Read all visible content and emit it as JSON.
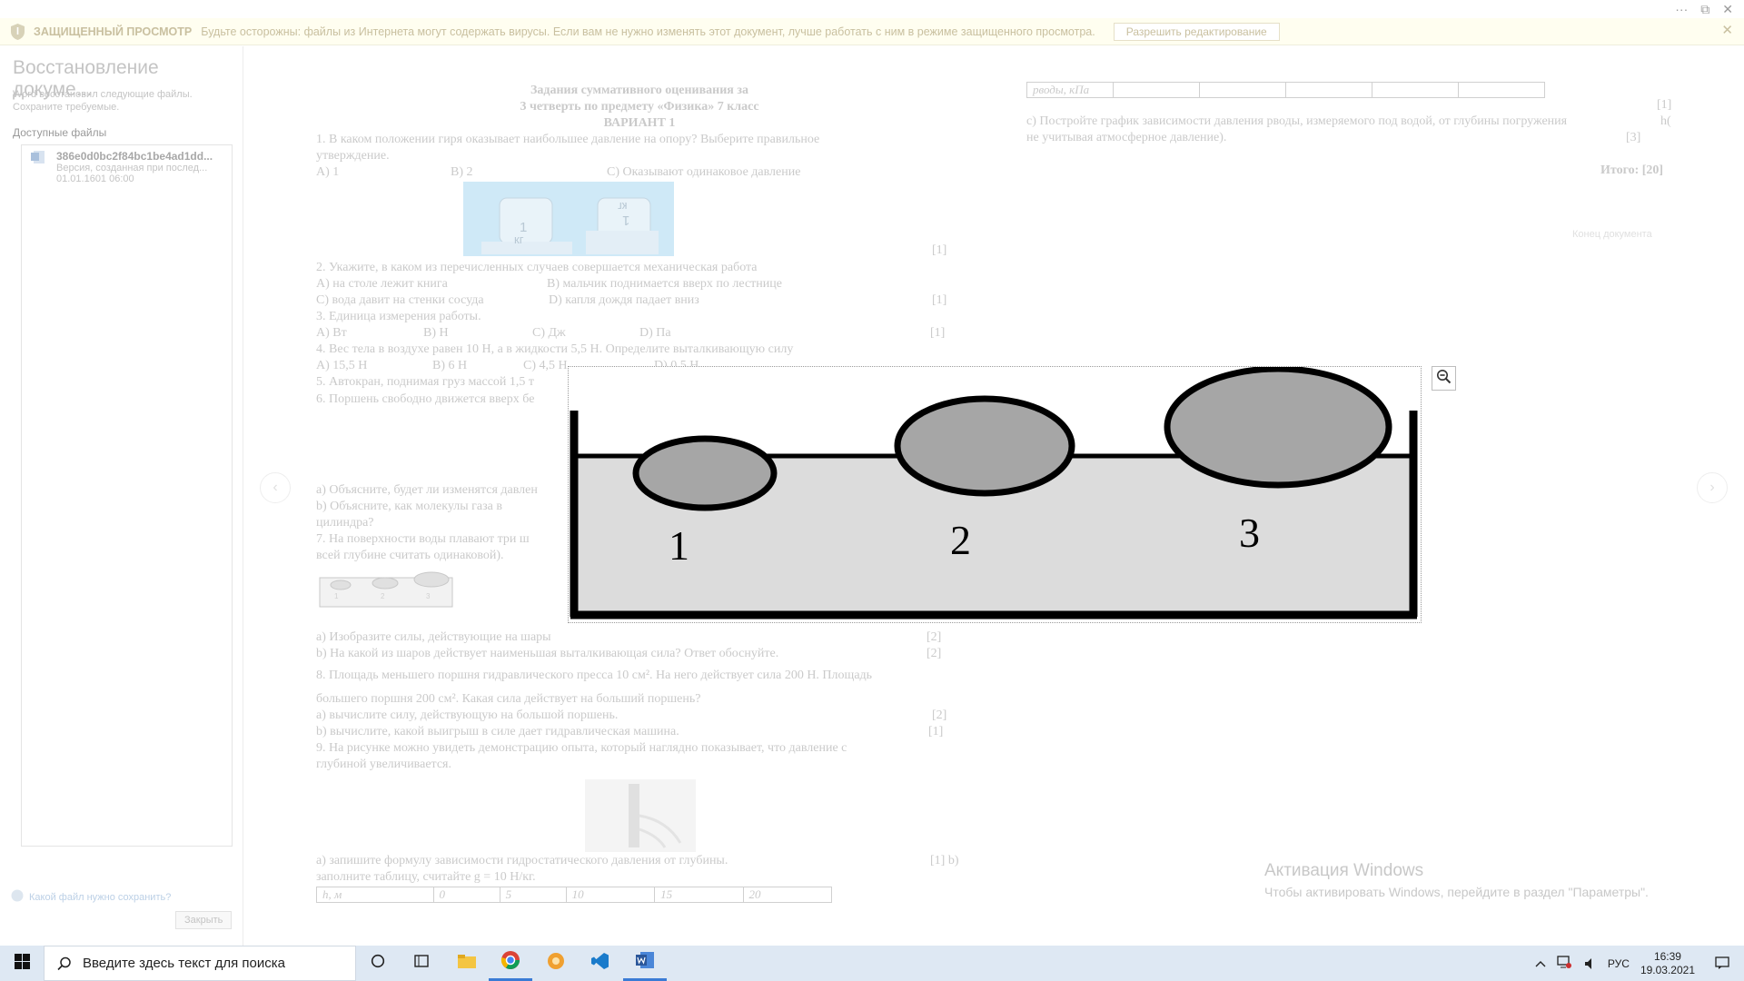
{
  "window": {
    "controls": [
      "···",
      "⧉",
      "✕"
    ]
  },
  "banner": {
    "title": "ЗАЩИЩЕННЫЙ ПРОСМОТР",
    "message": "Будьте осторожны: файлы из Интернета могут содержать вирусы. Если вам не нужно изменять этот документ, лучше работать с ним в режиме защищенного просмотра.",
    "enable_label": "Разрешить редактирование",
    "close": "✕"
  },
  "recovery": {
    "title": "Восстановление докуме...",
    "desc": "Word восстановил следующие файлы. Сохраните требуемые.",
    "available": "Доступные файлы",
    "file_name": "386e0d0bc2f84bc1be4ad1dd...",
    "file_version": "Версия, созданная при послед...",
    "file_date": "01.01.1601 06:00",
    "help": "Какой файл нужно сохранить?",
    "close_label": "Закрыть"
  },
  "doc": {
    "heading": [
      "Задания суммативного оценивания за",
      "3 четверть по предмету «Физика» 7 класс",
      "ВАРИАНТ 1"
    ],
    "q1": "1. В каком положении гиря оказывает наибольшее давление на опору? Выберите правильное",
    "q1b": "утверждение.",
    "q1_opts": [
      "А) 1",
      "В) 2",
      "С) Оказывают одинаковое давление"
    ],
    "mark1": "[1]",
    "q2": "2. Укажите, в каком из перечисленных случаев  совершается механическая работа",
    "q2_a": "А) на столе лежит книга",
    "q2_b": "В) мальчик поднимается вверх по лестнице",
    "q2_c": "С) вода давит на стенки сосуда",
    "q2_d": "D) капля дождя падает вниз",
    "q3": "3. Единица измерения работы.",
    "q3_opts": [
      "А) Вт",
      "В) Н",
      "С) Дж",
      "D) Па"
    ],
    "q4": "4. Вес тела в воздухе равен 10 Н, а в жидкости 5,5 Н. Определите выталкивающую силу",
    "q4_opts": [
      "А) 15,5 Н",
      "В) 6 Н",
      "С) 4,5 Н",
      "D) 0,5 Н"
    ],
    "q5": "5. Автокран, поднимая груз массой 1,5 т",
    "q6": "6. Поршень свободно движется вверх бе",
    "q6a": "а) Объясните, будет ли изменятся давлен",
    "q6b": "b) Объясните, как молекулы газа в",
    "q6b2": "цилиндра?",
    "q7": "7. На поверхности воды плавают три ш",
    "q7b": "всей глубине считать одинаковой).",
    "q7_a": "а) Изобразите силы, действующие на шары",
    "q7_b": "b) На какой из шаров действует наименьшая выталкивающая сила?  Ответ обоснуйте.",
    "mark2": "[2]",
    "q8": "8. Площадь меньшего поршня гидравлического пресса 10 см². На него действует сила 200 Н. Площадь",
    "q8b": "большего поршня 200 см². Какая сила действует на больший поршень?",
    "q8_a": "а) вычислите силу, действующую на большой поршень.",
    "q8_b": "b) вычислите, какой выигрыш в силе дает гидравлическая машина.",
    "q9": "9. На рисунке можно увидеть демонстрацию опыта, который наглядно показывает, что давление с",
    "q9b": "глубиной увеличивается.",
    "q9_a": "а) запишите формулу зависимости гидростатического давления от глубины.",
    "q9_mark": "[1] b)",
    "q9_b2": "заполните  таблицу, считайте g = 10 Н/кг.",
    "table_h": [
      "h, м",
      "0",
      "5",
      "10",
      "15",
      "20"
    ],
    "kettle_labels": [
      "1",
      "кг",
      "кг",
      "1"
    ],
    "bowl_labels": [
      "1",
      "2",
      "3"
    ]
  },
  "doc2": {
    "table_p": [
      "pводы, кПа",
      "",
      "",
      "",
      "",
      ""
    ],
    "mark_top": "[1]",
    "c_line1": "с) Постройте график зависимости давления pводы, измеряемого под водой, от глубины погружения",
    "c_h": "h(",
    "c_line2": "не учитывая атмосферное давление).",
    "mark3": "[3]",
    "total": "Итого: [20]",
    "end": "Конец документа"
  },
  "figure": {
    "labels": [
      "1",
      "2",
      "3"
    ],
    "zoom_icon": "zoom-out"
  },
  "activation": {
    "title": "Активация Windows",
    "text": "Чтобы активировать Windows, перейдите в раздел \"Параметры\"."
  },
  "taskbar": {
    "search_placeholder": "Введите здесь текст для поиска",
    "lang": "РУС",
    "time": "16:39",
    "date": "19.03.2021"
  }
}
